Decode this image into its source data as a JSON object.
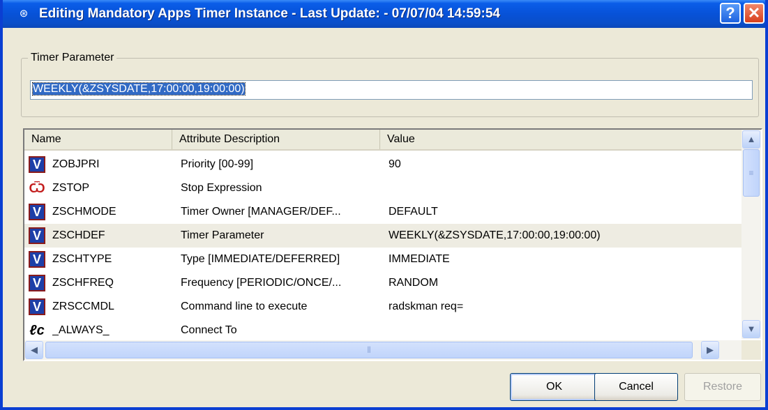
{
  "window": {
    "title": "Editing Mandatory Apps Timer Instance - Last Update: - 07/07/04 14:59:54",
    "app_icon": "satellite-icon",
    "help_label": "?",
    "close_label": "✕"
  },
  "timer_group": {
    "legend": "Timer Parameter",
    "value": "WEEKLY(&ZSYSDATE,17:00:00,19:00:00)"
  },
  "table": {
    "columns": [
      "Name",
      "Attribute Description",
      "Value"
    ],
    "rows": [
      {
        "icon": "variable-icon",
        "name": "ZOBJPRI",
        "description": "Priority [00-99]",
        "value": "90"
      },
      {
        "icon": "stop-expression-icon",
        "name": "ZSTOP",
        "description": "Stop Expression",
        "value": ""
      },
      {
        "icon": "variable-icon",
        "name": "ZSCHMODE",
        "description": "Timer Owner [MANAGER/DEF...",
        "value": "DEFAULT"
      },
      {
        "icon": "variable-icon",
        "name": "ZSCHDEF",
        "description": "Timer Parameter",
        "value": "WEEKLY(&ZSYSDATE,17:00:00,19:00:00)",
        "selected": true
      },
      {
        "icon": "variable-icon",
        "name": "ZSCHTYPE",
        "description": "Type [IMMEDIATE/DEFERRED]",
        "value": "IMMEDIATE"
      },
      {
        "icon": "variable-icon",
        "name": "ZSCHFREQ",
        "description": "Frequency [PERIODIC/ONCE/...",
        "value": "RANDOM"
      },
      {
        "icon": "variable-icon",
        "name": "ZRSCCMDL",
        "description": "Command line to execute",
        "value": "radskman req="
      },
      {
        "icon": "connect-icon",
        "name": "_ALWAYS_",
        "description": "Connect To",
        "value": ""
      }
    ],
    "selected_row_color": "#eeece2"
  },
  "buttons": {
    "ok": "OK",
    "cancel": "Cancel",
    "restore": "Restore"
  },
  "colors": {
    "title_bar": "#0752d8",
    "selection": "#316ac5"
  }
}
